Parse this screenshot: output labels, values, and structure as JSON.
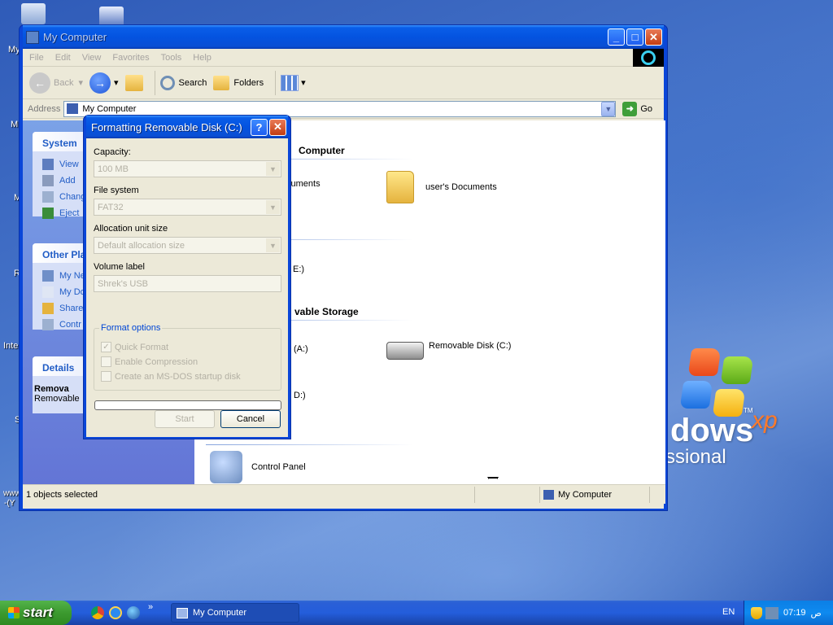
{
  "desktop": {
    "partial_labels": [
      "My",
      "M",
      "M",
      "R",
      "Inte",
      "S",
      "www",
      "-(Y"
    ],
    "wallpaper_text": {
      "brand_fragment": "dows",
      "xp": "xp",
      "edition_fragment": "ssional",
      "tm": "TM"
    }
  },
  "window": {
    "title": "My Computer",
    "menu": [
      "File",
      "Edit",
      "View",
      "Favorites",
      "Tools",
      "Help"
    ],
    "toolbar": {
      "back": "Back",
      "search": "Search",
      "folders": "Folders"
    },
    "address": {
      "label": "Address",
      "value": "My Computer",
      "go": "Go"
    },
    "sidebar": {
      "system": {
        "title": "System",
        "items": [
          "View",
          "Add",
          "Chang",
          "Eject"
        ]
      },
      "other": {
        "title": "Other Pla",
        "items": [
          "My Ne",
          "My Do",
          "Share",
          "Contr"
        ]
      },
      "details": {
        "title": "Details",
        "line1": "Remova",
        "line2": "Removable"
      }
    },
    "sections": {
      "files": "Computer",
      "removable": "vable Storage"
    },
    "items": {
      "docs_partial": "cuments",
      "user_docs": "user's Documents",
      "drive_e": "E:)",
      "drive_a": "(A:)",
      "removable_c": "Removable Disk (C:)",
      "drive_d": "D:)",
      "control_panel": "Control Panel"
    },
    "status": {
      "left": "1 objects selected",
      "right": "My Computer"
    }
  },
  "dialog": {
    "title": "Formatting Removable Disk (C:)",
    "capacity_label": "Capacity:",
    "capacity_value": "100 MB",
    "fs_label": "File system",
    "fs_value": "FAT32",
    "alloc_label": "Allocation unit size",
    "alloc_value": "Default allocation size",
    "vol_label": "Volume label",
    "vol_value": "Shrek's USB",
    "options_label": "Format options",
    "opt_quick": "Quick Format",
    "opt_compress": "Enable Compression",
    "opt_msdos": "Create an MS-DOS startup disk",
    "start": "Start",
    "cancel": "Cancel"
  },
  "taskbar": {
    "start": "start",
    "task": "My Computer",
    "overflow": "»",
    "lang": "EN",
    "time": "07:19",
    "ampm": "ص"
  }
}
